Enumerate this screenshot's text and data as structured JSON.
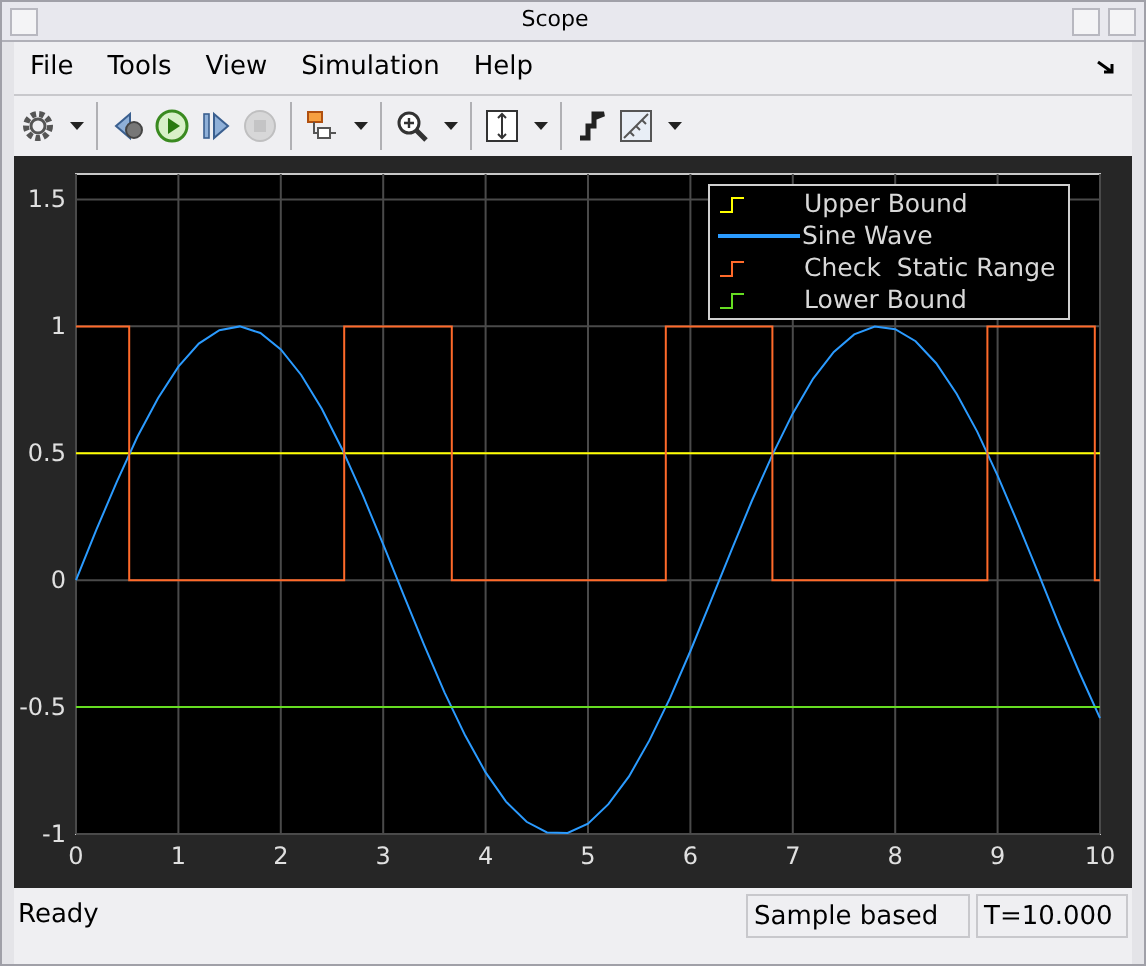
{
  "window": {
    "title": "Scope"
  },
  "menu": [
    {
      "label": "File"
    },
    {
      "label": "Tools"
    },
    {
      "label": "View"
    },
    {
      "label": "Simulation"
    },
    {
      "label": "Help"
    }
  ],
  "toolbar": [
    {
      "kind": "settings",
      "disabled": false,
      "dropdown": true
    },
    {
      "kind": "separator"
    },
    {
      "kind": "step-back",
      "disabled": false,
      "dropdown": false
    },
    {
      "kind": "run",
      "disabled": false,
      "dropdown": false
    },
    {
      "kind": "step-forward",
      "disabled": false,
      "dropdown": false
    },
    {
      "kind": "stop",
      "disabled": true,
      "dropdown": false
    },
    {
      "kind": "separator"
    },
    {
      "kind": "hierarchy",
      "disabled": false,
      "dropdown": true
    },
    {
      "kind": "separator"
    },
    {
      "kind": "zoom",
      "disabled": false,
      "dropdown": true
    },
    {
      "kind": "separator"
    },
    {
      "kind": "scale",
      "disabled": false,
      "dropdown": true
    },
    {
      "kind": "separator"
    },
    {
      "kind": "highlight",
      "disabled": false,
      "dropdown": false
    },
    {
      "kind": "ruler",
      "disabled": false,
      "dropdown": true
    }
  ],
  "plot": {
    "legend": [
      {
        "kind": "step"
      },
      {
        "kind": "line"
      },
      {
        "kind": "step"
      },
      {
        "kind": "step"
      }
    ],
    "chart_data": {
      "type": "line",
      "grid": true,
      "xlim": [
        0,
        10
      ],
      "ylim": [
        -1,
        1.6
      ],
      "xticks": [
        0,
        1,
        2,
        3,
        4,
        5,
        6,
        7,
        8,
        9,
        10
      ],
      "yticks": [
        -1,
        {
          "value": -0.5,
          "label": "-0.5"
        },
        0,
        {
          "value": 0.5,
          "label": "0.5"
        },
        1,
        {
          "value": 1.5,
          "label": "1.5"
        }
      ],
      "series": [
        {
          "name": "Upper Bound",
          "color": "#ffff00",
          "x": [
            0,
            10
          ],
          "values": [
            0.5,
            0.5
          ]
        },
        {
          "name": "Sine Wave",
          "color": "#2b9bff",
          "x": [
            0,
            0.2,
            0.4,
            0.6,
            0.8,
            1,
            1.2,
            1.4,
            1.6,
            1.8,
            2,
            2.2,
            2.4,
            2.6,
            2.8,
            3,
            3.2,
            3.4,
            3.6,
            3.8,
            4,
            4.2,
            4.4,
            4.6,
            4.8,
            5,
            5.2,
            5.4,
            5.6,
            5.8,
            6,
            6.2,
            6.4,
            6.6,
            6.8,
            7,
            7.2,
            7.4,
            7.6,
            7.8,
            8,
            8.2,
            8.4,
            8.6,
            8.8,
            9,
            9.2,
            9.4,
            9.6,
            9.8,
            10
          ],
          "values": [
            0,
            0.199,
            0.389,
            0.565,
            0.717,
            0.841,
            0.932,
            0.985,
            1,
            0.974,
            0.909,
            0.808,
            0.675,
            0.516,
            0.335,
            0.141,
            -0.058,
            -0.256,
            -0.443,
            -0.612,
            -0.757,
            -0.872,
            -0.952,
            -0.994,
            -0.996,
            -0.959,
            -0.883,
            -0.773,
            -0.631,
            -0.465,
            -0.279,
            -0.083,
            0.117,
            0.312,
            0.494,
            0.657,
            0.794,
            0.899,
            0.968,
            0.999,
            0.989,
            0.941,
            0.855,
            0.734,
            0.585,
            0.412,
            0.223,
            0.025,
            -0.175,
            -0.366,
            -0.544
          ]
        },
        {
          "name": "Check  Static Range",
          "color": "#ff6a2a",
          "x": [
            0,
            0.52,
            0.52,
            2.62,
            2.62,
            3.67,
            3.67,
            5.76,
            5.76,
            6.8,
            6.8,
            8.9,
            8.9,
            9.95,
            9.95,
            10
          ],
          "values": [
            1,
            1,
            0,
            0,
            1,
            1,
            0,
            0,
            1,
            1,
            0,
            0,
            1,
            1,
            0,
            0
          ]
        },
        {
          "name": "Lower Bound",
          "color": "#66dd22",
          "x": [
            0,
            10
          ],
          "values": [
            -0.5,
            -0.5
          ]
        }
      ]
    }
  },
  "status_bar": {
    "message": "Ready",
    "mode": "Sample based",
    "time": "T=10.000"
  }
}
